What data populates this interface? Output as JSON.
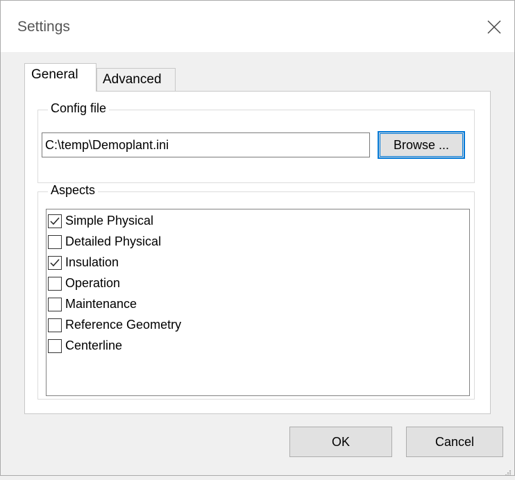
{
  "window": {
    "title": "Settings"
  },
  "tabs": [
    {
      "label": "General",
      "active": true
    },
    {
      "label": "Advanced",
      "active": false
    }
  ],
  "config_file": {
    "legend": "Config file",
    "path": "C:\\temp\\Demoplant.ini",
    "browse_label": "Browse ..."
  },
  "aspects": {
    "legend": "Aspects",
    "items": [
      {
        "label": "Simple Physical",
        "checked": true
      },
      {
        "label": "Detailed Physical",
        "checked": false
      },
      {
        "label": "Insulation",
        "checked": true
      },
      {
        "label": "Operation",
        "checked": false
      },
      {
        "label": "Maintenance",
        "checked": false
      },
      {
        "label": "Reference Geometry",
        "checked": false
      },
      {
        "label": "Centerline",
        "checked": false
      }
    ]
  },
  "buttons": {
    "ok": "OK",
    "cancel": "Cancel"
  },
  "colors": {
    "focus_accent": "#0078d7",
    "button_face": "#e1e1e1",
    "window_bg": "#f0f0f0"
  },
  "icons": {
    "close": "close-icon",
    "check": "checkmark-icon",
    "grip": "resize-grip-icon"
  }
}
